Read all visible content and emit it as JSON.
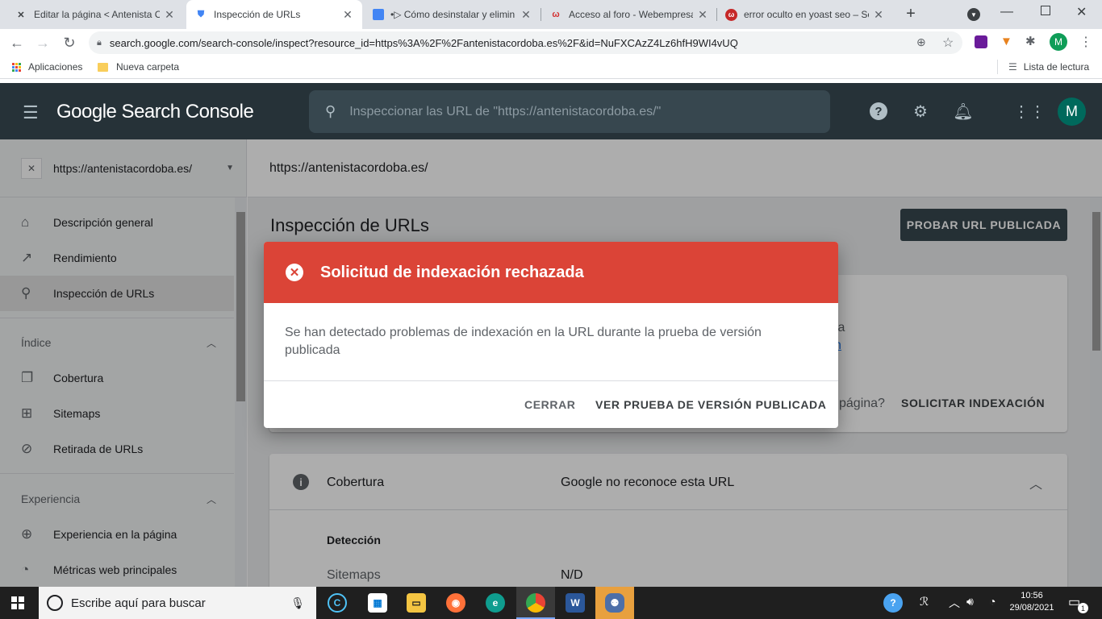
{
  "browser": {
    "tabs": [
      {
        "title": "Editar la página < Antenista C",
        "favicon": "wordpress-icon"
      },
      {
        "title": "Inspección de URLs",
        "favicon": "search-console-icon"
      },
      {
        "title": "•▷ Cómo desinstalar y elimin",
        "favicon": "page-icon"
      },
      {
        "title": "Acceso al foro - Webempresa",
        "favicon": "webempresa-icon"
      },
      {
        "title": "error oculto en yoast seo – Sc",
        "favicon": "webempresa-circle-icon"
      }
    ],
    "url": "search.google.com/search-console/inspect?resource_id=https%3A%2F%2Fantenistacordoba.es%2F&id=NuFXCAzZ4Lz6hfH9WI4vUQ",
    "profile_initial": "M",
    "bookmarks": {
      "apps": "Aplicaciones",
      "folder": "Nueva carpeta",
      "reading_list": "Lista de lectura"
    }
  },
  "gsc": {
    "logo": "Google Search Console",
    "search_placeholder": "Inspeccionar las URL de \"https://antenistacordoba.es/\"",
    "avatar": "M",
    "property": "https://antenistacordoba.es/",
    "breadcrumb": "https://antenistacordoba.es/",
    "sidebar": {
      "items_top": [
        {
          "label": "Descripción general",
          "icon": "home-icon"
        },
        {
          "label": "Rendimiento",
          "icon": "trending-icon"
        },
        {
          "label": "Inspección de URLs",
          "icon": "search-icon"
        }
      ],
      "section_index": "Índice",
      "items_index": [
        {
          "label": "Cobertura",
          "icon": "copy-icon"
        },
        {
          "label": "Sitemaps",
          "icon": "sitemap-icon"
        },
        {
          "label": "Retirada de URLs",
          "icon": "eye-off-icon"
        }
      ],
      "section_experience": "Experiencia",
      "items_experience": [
        {
          "label": "Experiencia en la página",
          "icon": "plus-circle-icon"
        },
        {
          "label": "Métricas web principales",
          "icon": "speed-icon"
        }
      ]
    },
    "page_title": "Inspección de URLs",
    "test_live_button": "PROBAR URL PUBLICADA",
    "partial_text_1": "ta",
    "partial_text_2": "n",
    "partial_text_3": "página?",
    "request_indexing": "SOLICITAR INDEXACIÓN",
    "coverage": {
      "label": "Cobertura",
      "status": "Google no reconoce esta URL",
      "detection": "Detección",
      "sitemaps_label": "Sitemaps",
      "sitemaps_value": "N/D"
    }
  },
  "dialog": {
    "title": "Solicitud de indexación rechazada",
    "body": "Se han detectado problemas de indexación en la URL durante la prueba de versión publicada",
    "close": "CERRAR",
    "view_test": "VER PRUEBA DE VERSIÓN PUBLICADA",
    "header_color": "#db4437"
  },
  "taskbar": {
    "search_placeholder": "Escribe aquí para buscar",
    "time": "10:56",
    "date": "29/08/2021",
    "notifications": "1"
  }
}
